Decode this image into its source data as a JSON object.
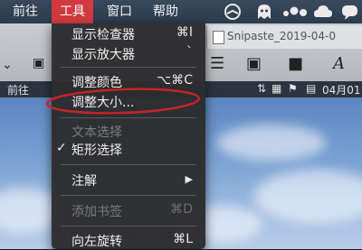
{
  "menubar": {
    "items": [
      {
        "label": "前往"
      },
      {
        "label": "工具"
      },
      {
        "label": "窗口"
      },
      {
        "label": "帮助"
      }
    ],
    "status_icons": [
      "speedometer-icon",
      "ghost-icon",
      "dots-icon",
      "cloud-icon",
      "bubble-icon"
    ]
  },
  "tools_menu": {
    "items": [
      {
        "label": "显示检查器",
        "shortcut": "⌘I"
      },
      {
        "label": "显示放大器",
        "shortcut": "`"
      },
      {
        "label": "调整颜色",
        "shortcut": "⌥⌘C"
      },
      {
        "label": "调整大小...",
        "shortcut": ""
      },
      {
        "label": "文本选择",
        "shortcut": "",
        "disabled": true
      },
      {
        "label": "矩形选择",
        "shortcut": "",
        "checked": true
      },
      {
        "label": "注解",
        "shortcut": "▶"
      },
      {
        "label": "添加书签",
        "shortcut": "⌘D",
        "disabled": true
      },
      {
        "label": "向左旋转",
        "shortcut": "⌘L"
      }
    ],
    "check_glyph": "✓"
  },
  "background": {
    "tab_title": "Snipaste_2019-04-0",
    "secondary_label": "前往",
    "date_label": "04月01"
  },
  "colors": {
    "active_menu": "#d23a3f",
    "menu_bg": "#2c2c2e",
    "annotation": "#c0262b"
  }
}
